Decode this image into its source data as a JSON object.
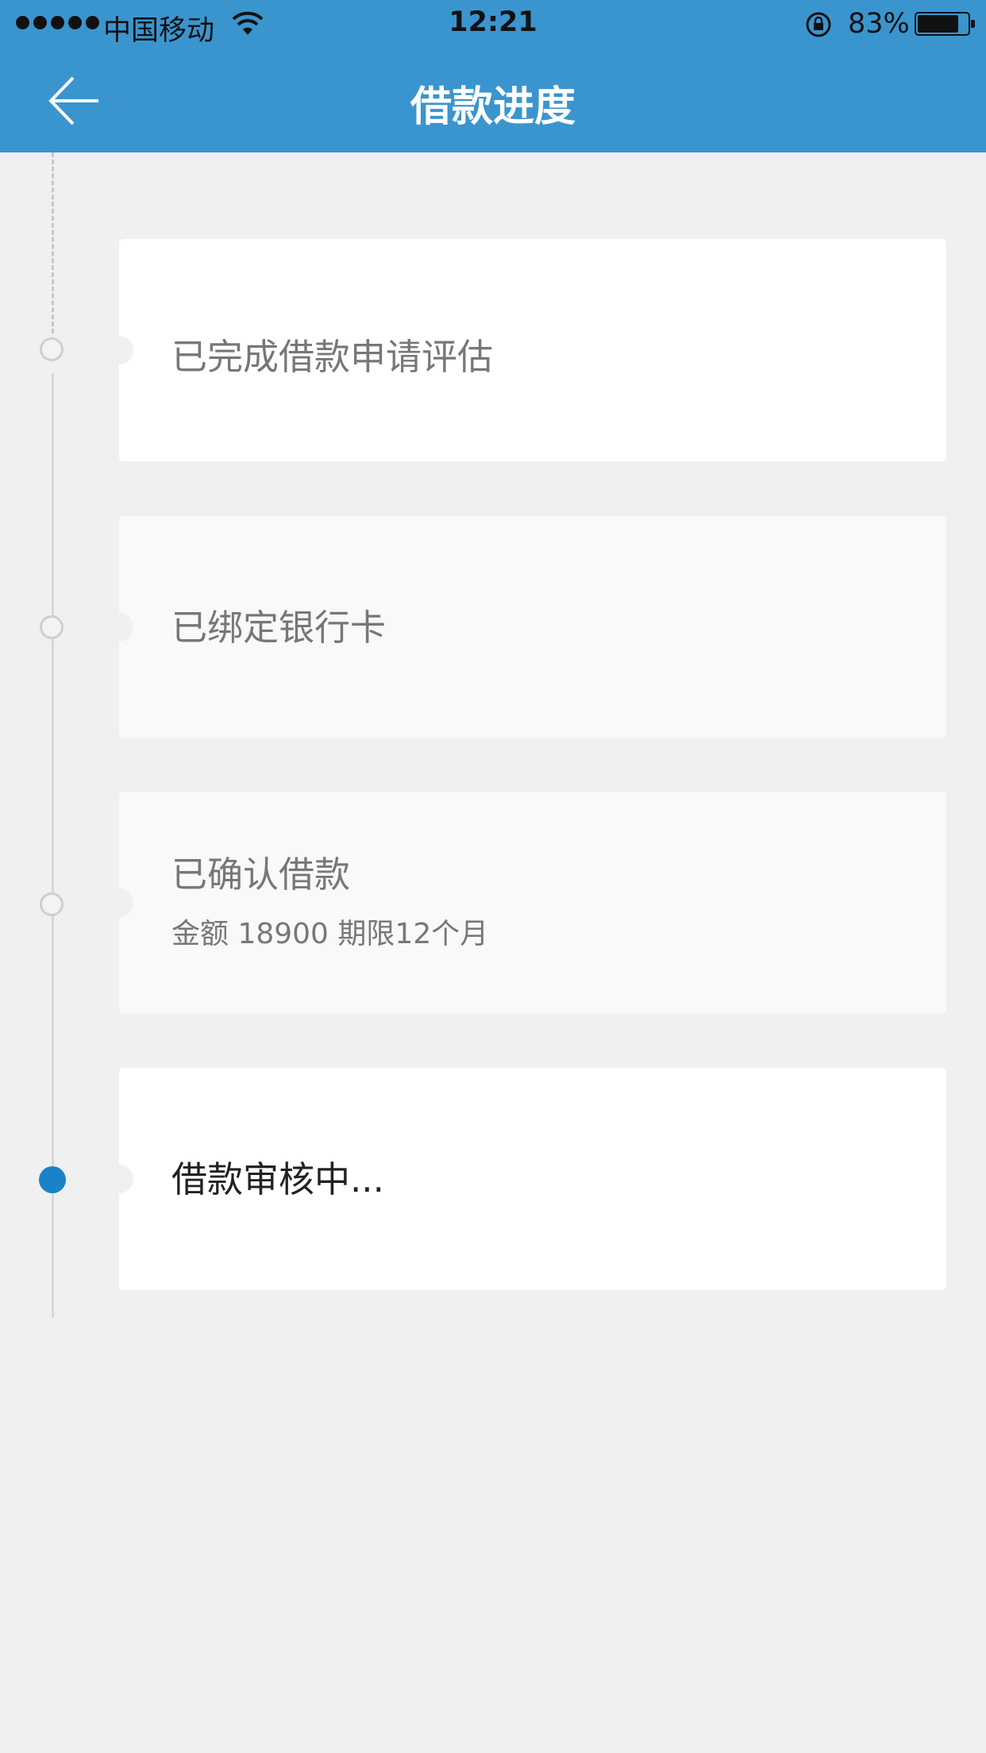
{
  "status_bar": {
    "carrier": "中国移动",
    "time": "12:21",
    "battery_percent": "83%",
    "battery_level": 0.83
  },
  "header": {
    "title": "借款进度",
    "back_icon": "arrow-left-icon"
  },
  "colors": {
    "header_bg": "#3a95cf",
    "active_node": "#1a82c9",
    "page_bg": "#f0f0f0"
  },
  "steps": [
    {
      "label": "已完成借款申请评估",
      "sub": "",
      "state": "done"
    },
    {
      "label": "已绑定银行卡",
      "sub": "",
      "state": "done"
    },
    {
      "label": "已确认借款",
      "sub": "金额 18900  期限12个月",
      "state": "done"
    },
    {
      "label": "借款审核中...",
      "sub": "",
      "state": "active"
    }
  ]
}
